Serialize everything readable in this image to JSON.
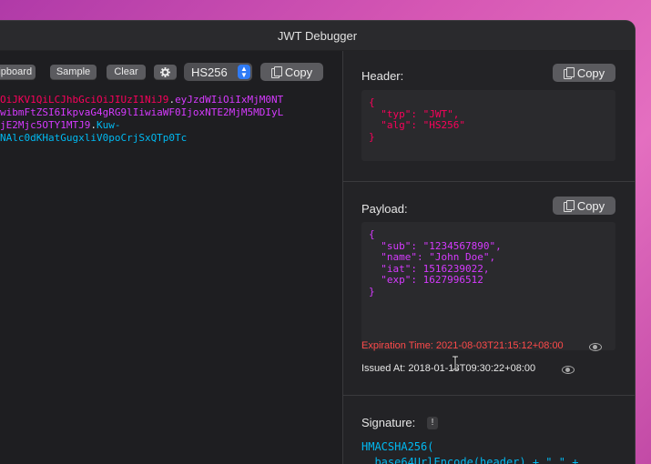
{
  "window": {
    "title": "JWT Debugger"
  },
  "toolbar": {
    "clipboard_label": "lipboard",
    "sample_label": "Sample",
    "clear_label": "Clear",
    "algorithm": "HS256",
    "copy_label": "Copy"
  },
  "token": {
    "line1_header": "OiJKV1QiLCJhbGciOiJIUzI1NiJ9",
    "line1_dot": ".",
    "line1_payload": "eyJzdWIiOiIxMjM0NT",
    "line2_payload": "wibmFtZSI6IkpvaG4gRG9lIiwiaWF0IjoxNTE2MjM5MDIyL",
    "line3_payload": "jE2Mjc5OTY1MTJ9",
    "line3_dot": ".",
    "line3_sig": "Kuw-",
    "line4_sig": "NAlc0dKHatGugxliV0poCrjSxQTp0Tc"
  },
  "header": {
    "label": "Header:",
    "copy_label": "Copy",
    "json_lines": [
      "{",
      "  \"typ\": \"JWT\",",
      "  \"alg\": \"HS256\"",
      "}"
    ]
  },
  "payload": {
    "label": "Payload:",
    "copy_label": "Copy",
    "json_lines": [
      "{",
      "  \"sub\": \"1234567890\",",
      "  \"name\": \"John Doe\",",
      "  \"iat\": 1516239022,",
      "  \"exp\": 1627996512",
      "}"
    ],
    "expiration_text": "Expiration Time: 2021-08-03T21:15:12+08:00",
    "issued_text": "Issued At: 2018-01-18T09:30:22+08:00"
  },
  "signature": {
    "label": "Signature:",
    "badge": "!",
    "code_line1": "HMACSHA256(",
    "code_line2": "  base64UrlEncode(header) + \".\" +"
  },
  "colors": {
    "header": "#fb015b",
    "payload": "#d63aff",
    "signature": "#00b9f1",
    "expiration": "#ff4a4a",
    "accent": "#2f7bf5"
  },
  "icons": [
    "copy-icon",
    "gear-icon",
    "chevron-updown-icon",
    "eye-icon",
    "text-cursor-icon"
  ]
}
